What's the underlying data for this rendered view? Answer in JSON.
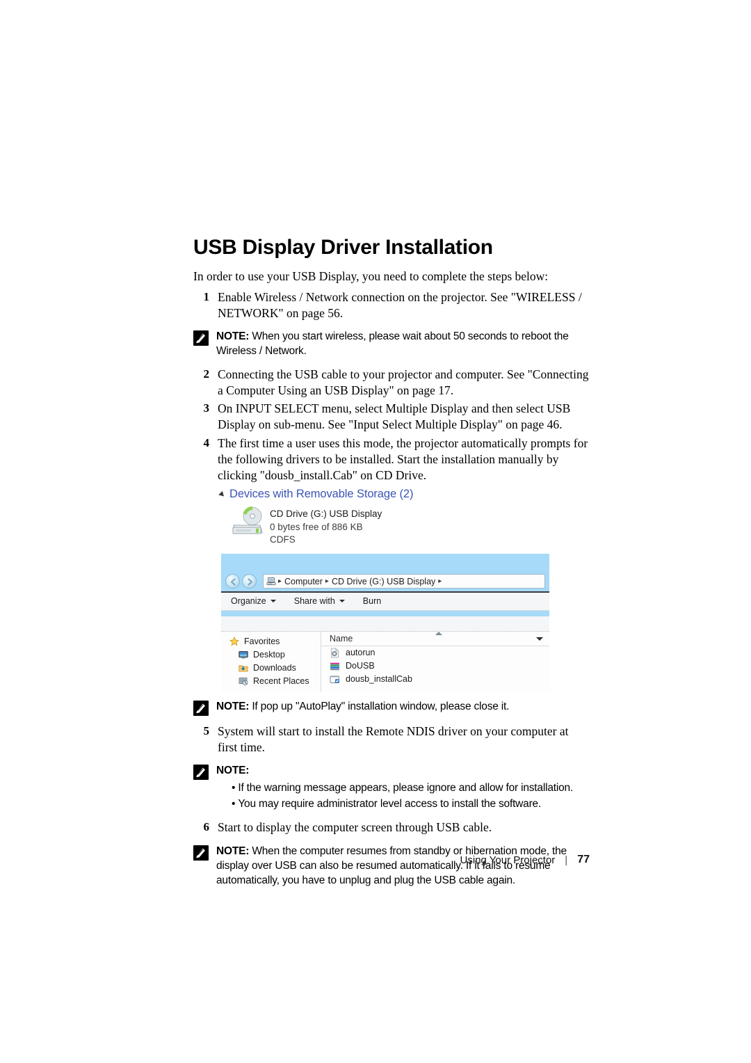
{
  "document": {
    "title": "USB Display Driver Installation",
    "intro": "In order to use your USB Display, you need to complete the steps below:"
  },
  "steps": [
    {
      "num": "1",
      "text": "Enable Wireless / Network connection on the projector. See \"WIRELESS / NETWORK\" on page 56."
    },
    {
      "num": "2",
      "text": "Connecting the USB cable to your projector and computer. See \"Connecting a Computer Using an USB Display\" on page 17."
    },
    {
      "num": "3",
      "text": "On INPUT SELECT menu, select Multiple Display and then select USB Display on sub-menu. See \"Input Select Multiple Display\" on page 46."
    },
    {
      "num": "4",
      "text": "The first time a user uses this mode, the projector automatically prompts for the following drivers to be installed. Start the installation manually by clicking \"dousb_install.Cab\" on CD Drive."
    },
    {
      "num": "5",
      "text": "System will start to install the Remote NDIS driver on your computer at first time."
    },
    {
      "num": "6",
      "text": "Start to display the computer screen through USB cable."
    }
  ],
  "notes": {
    "label": "NOTE:",
    "label_plain": "NOTE:",
    "note1": "When you start wireless, please wait about 50 seconds to reboot the Wireless / Network.",
    "note2": "If pop up \"AutoPlay\" installation window, please close it.",
    "note3_bullets": [
      "If the warning message appears, please ignore and allow for installation.",
      "You may require administrator level access to install the software."
    ],
    "note4": "When the computer resumes from standby or hibernation mode, the display over USB can also be resumed automatically. If it fails to resume automatically, you have to unplug and plug the USB cable again."
  },
  "storage_figure": {
    "group_header": "Devices with Removable Storage (2)",
    "group_header_color": "#3b55b5",
    "drive_name": "CD Drive (G:) USB Display",
    "drive_capacity": "0 bytes free of 886 KB",
    "drive_filesystem": "CDFS"
  },
  "explorer": {
    "address": {
      "crumbs": [
        "Computer",
        "CD Drive (G:) USB Display"
      ],
      "separator": "▸"
    },
    "toolbar": [
      {
        "label": "Organize",
        "has_caret": true
      },
      {
        "label": "Share with",
        "has_caret": true
      },
      {
        "label": "Burn",
        "has_caret": false
      }
    ],
    "sidebar": [
      {
        "label": "Favorites",
        "icon": "star-icon",
        "indent": false
      },
      {
        "label": "Desktop",
        "icon": "monitor-icon",
        "indent": true
      },
      {
        "label": "Downloads",
        "icon": "downloads-folder-icon",
        "indent": true
      },
      {
        "label": "Recent Places",
        "icon": "recent-places-icon",
        "indent": true
      }
    ],
    "column_header": "Name",
    "files": [
      {
        "label": "autorun",
        "icon": "config-file-icon"
      },
      {
        "label": "DoUSB",
        "icon": "application-icon"
      },
      {
        "label": "dousb_installCab",
        "icon": "cabinet-file-icon"
      }
    ],
    "colors": {
      "titlebar": "#a6daf8",
      "toolbar": "#f4f6f7",
      "body": "#fdfdfd"
    }
  },
  "footer": {
    "section": "Using Your Projector",
    "divider": "|",
    "page": "77"
  }
}
